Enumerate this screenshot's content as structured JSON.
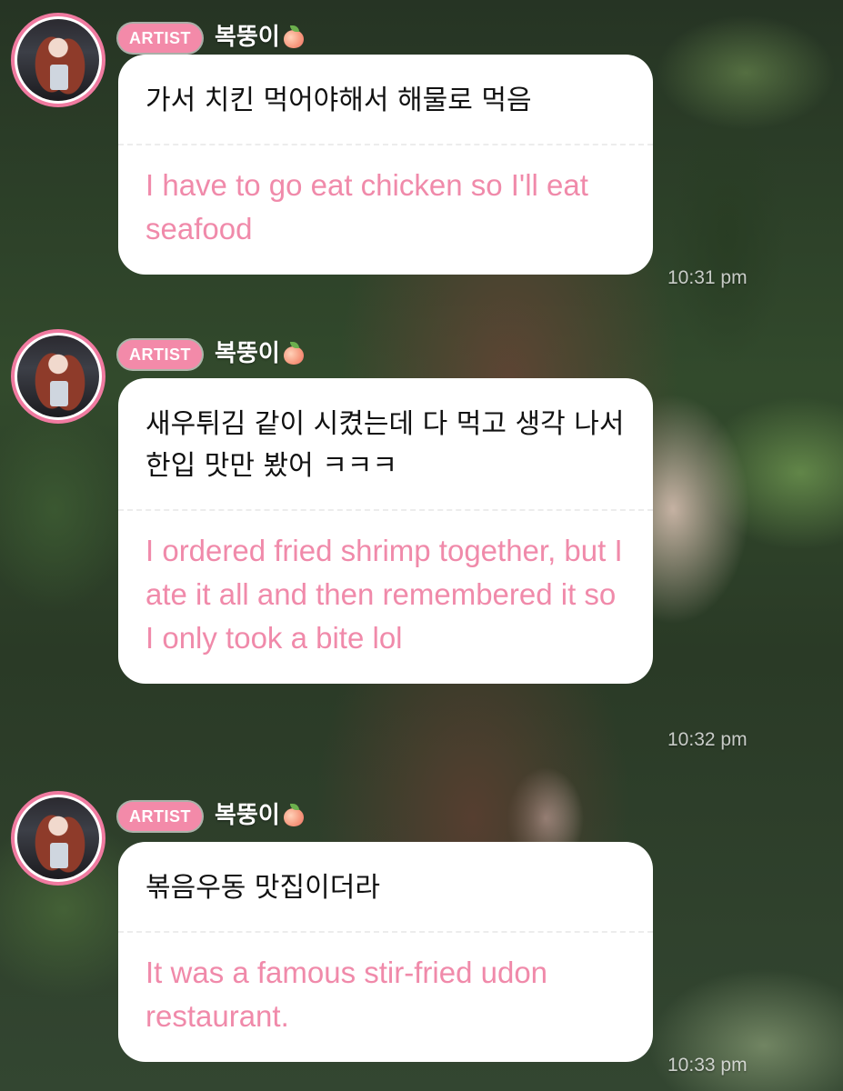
{
  "messages": [
    {
      "badge": "ARTIST",
      "username": "복뚱이",
      "username_icon": "peach-icon",
      "original": "가서 치킨 먹어야해서 해물로 먹음",
      "translation": "I have to go eat chicken so I'll eat seafood",
      "time": "10:31 pm"
    },
    {
      "badge": "ARTIST",
      "username": "복뚱이",
      "username_icon": "peach-icon",
      "original": "새우튀김 같이 시켰는데 다 먹고 생각 나서 한입 맛만 봤어 ㅋㅋㅋ",
      "translation": "I ordered fried shrimp together, but I ate it all and then remembered it so I only took a bite lol",
      "time": "10:32 pm"
    },
    {
      "badge": "ARTIST",
      "username": "복뚱이",
      "username_icon": "peach-icon",
      "original": "볶음우동 맛집이더라",
      "translation": "It was a famous stir-fried udon restaurant.",
      "time": "10:33 pm"
    }
  ],
  "colors": {
    "badge": "#f38aa9",
    "avatar_ring": "#f07aa0",
    "translation_text": "#f08aaa",
    "bubble": "#ffffff"
  }
}
